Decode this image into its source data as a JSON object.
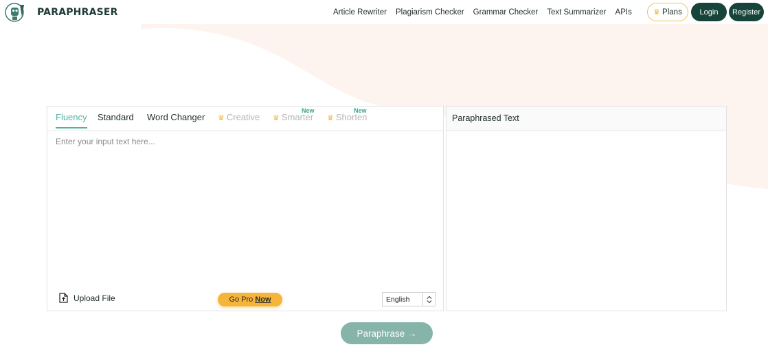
{
  "brand": {
    "name": "PARAPHRASER",
    "logo_icon": "robot-pen-icon"
  },
  "nav": {
    "links": [
      "Article Rewriter",
      "Plagiarism Checker",
      "Grammar Checker",
      "Text Summarizer",
      "APIs"
    ],
    "plans_label": "Plans",
    "login_label": "Login",
    "register_label": "Register"
  },
  "modes": {
    "tabs": [
      {
        "label": "Fluency",
        "active": true,
        "locked": false
      },
      {
        "label": "Standard",
        "active": false,
        "locked": false
      },
      {
        "label": "Word Changer",
        "active": false,
        "locked": false
      },
      {
        "label": "Creative",
        "active": false,
        "locked": true
      },
      {
        "label": "Smarter",
        "active": false,
        "locked": true,
        "badge": "New"
      },
      {
        "label": "Shorten",
        "active": false,
        "locked": true,
        "badge": "New"
      }
    ]
  },
  "input": {
    "placeholder": "Enter your input text here..."
  },
  "toolbar": {
    "upload_label": "Upload File",
    "gopro_label": "Go Pro",
    "gopro_emphasis": "Now",
    "language": "English"
  },
  "output": {
    "title": "Paraphrased Text"
  },
  "action": {
    "paraphrase_label": "Paraphrase →"
  },
  "colors": {
    "brand_dark": "#17443a",
    "accent_teal": "#4fb3a3",
    "gold": "#f5b43a",
    "button_disabled": "#86b4a8",
    "background_blob": "#fdf3ef"
  }
}
